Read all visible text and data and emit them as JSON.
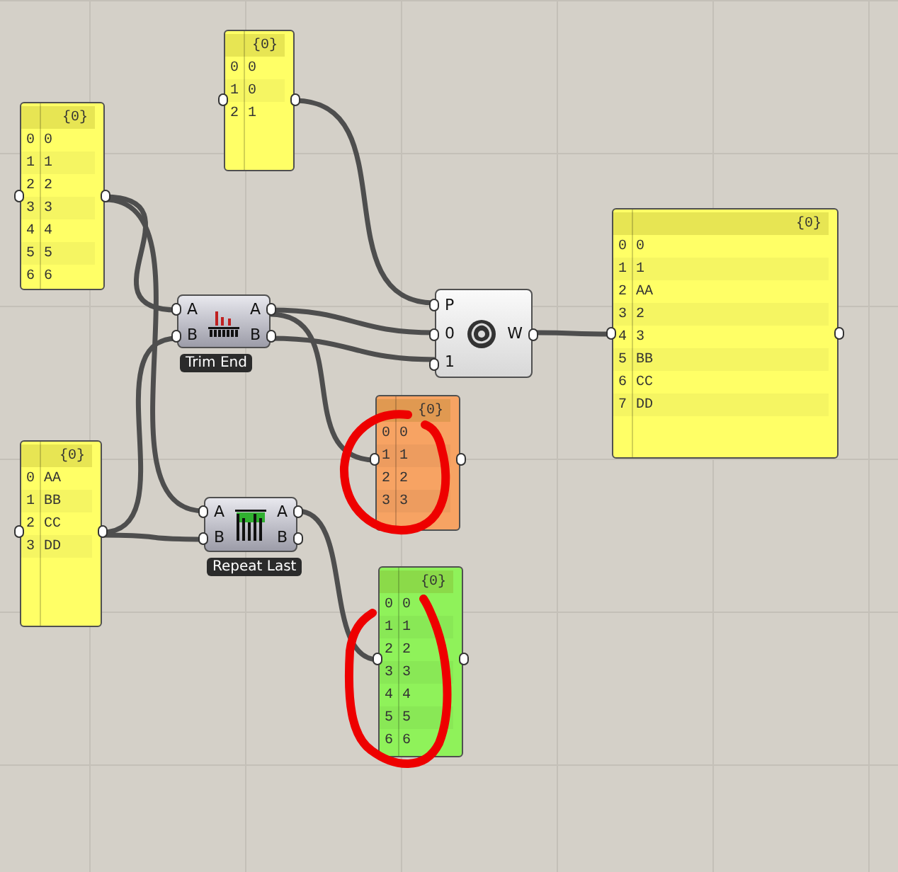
{
  "panels": [
    {
      "header": "{0}",
      "color": "#ffff66",
      "items": [
        {
          "index": "0",
          "value": "0"
        },
        {
          "index": "1",
          "value": "1"
        },
        {
          "index": "2",
          "value": "2"
        },
        {
          "index": "3",
          "value": "3"
        },
        {
          "index": "4",
          "value": "4"
        },
        {
          "index": "5",
          "value": "5"
        },
        {
          "index": "6",
          "value": "6"
        }
      ]
    },
    {
      "header": "{0}",
      "color": "#ffff66",
      "items": [
        {
          "index": "0",
          "value": "0"
        },
        {
          "index": "1",
          "value": "0"
        },
        {
          "index": "2",
          "value": "1"
        }
      ]
    },
    {
      "header": "{0}",
      "color": "#ffff66",
      "items": [
        {
          "index": "0",
          "value": "AA"
        },
        {
          "index": "1",
          "value": "BB"
        },
        {
          "index": "2",
          "value": "CC"
        },
        {
          "index": "3",
          "value": "DD"
        }
      ]
    },
    {
      "header": "{0}",
      "color": "#ffff66",
      "items": [
        {
          "index": "0",
          "value": "0"
        },
        {
          "index": "1",
          "value": "1"
        },
        {
          "index": "2",
          "value": "AA"
        },
        {
          "index": "3",
          "value": "2"
        },
        {
          "index": "4",
          "value": "3"
        },
        {
          "index": "5",
          "value": "BB"
        },
        {
          "index": "6",
          "value": "CC"
        },
        {
          "index": "7",
          "value": "DD"
        }
      ]
    },
    {
      "header": "{0}",
      "color": "#f7a363",
      "items": [
        {
          "index": "0",
          "value": "0"
        },
        {
          "index": "1",
          "value": "1"
        },
        {
          "index": "2",
          "value": "2"
        },
        {
          "index": "3",
          "value": "3"
        }
      ]
    },
    {
      "header": "{0}",
      "color": "#8ff25a",
      "items": [
        {
          "index": "0",
          "value": "0"
        },
        {
          "index": "1",
          "value": "1"
        },
        {
          "index": "2",
          "value": "2"
        },
        {
          "index": "3",
          "value": "3"
        },
        {
          "index": "4",
          "value": "4"
        },
        {
          "index": "5",
          "value": "5"
        },
        {
          "index": "6",
          "value": "6"
        }
      ]
    }
  ],
  "components": [
    {
      "kind": "trim",
      "label": "Trim End",
      "inputs": [
        "A",
        "B"
      ],
      "outputs": [
        "A",
        "B"
      ]
    },
    {
      "kind": "repeat",
      "label": "Repeat Last",
      "inputs": [
        "A",
        "B"
      ],
      "outputs": [
        "A",
        "B"
      ]
    },
    {
      "kind": "weave",
      "inputs": [
        "P",
        "0",
        "1"
      ],
      "outputs": [
        "W"
      ]
    }
  ]
}
